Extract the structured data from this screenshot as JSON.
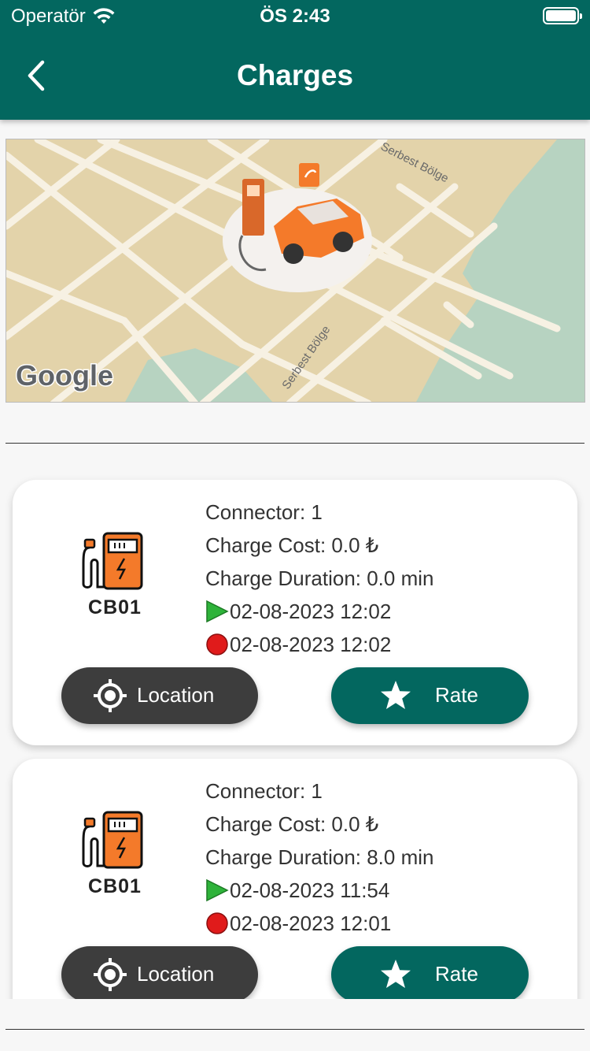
{
  "status_bar": {
    "carrier": "Operatör",
    "time": "ÖS 2:43"
  },
  "nav": {
    "title": "Charges"
  },
  "map": {
    "logo": "Google",
    "street_labels": [
      "Serbest Bölge",
      "Serbest Bölge"
    ]
  },
  "charges": [
    {
      "station": "CB01",
      "connector": "Connector:  1",
      "cost": "Charge Cost:  0.0 ₺",
      "duration": "Charge Duration: 0.0 min",
      "start": "02-08-2023 12:02",
      "stop": "02-08-2023 12:02",
      "location_label": "Location",
      "rate_label": "Rate"
    },
    {
      "station": "CB01",
      "connector": "Connector:  1",
      "cost": "Charge Cost:  0.0 ₺",
      "duration": "Charge Duration: 8.0 min",
      "start": "02-08-2023 11:54",
      "stop": "02-08-2023 12:01",
      "location_label": "Location",
      "rate_label": "Rate"
    }
  ],
  "colors": {
    "primary": "#03675f",
    "dark_button": "#3d3d3d",
    "station_orange": "#f47a2a",
    "start_green": "#2eb33a",
    "stop_red": "#e01b1b"
  }
}
